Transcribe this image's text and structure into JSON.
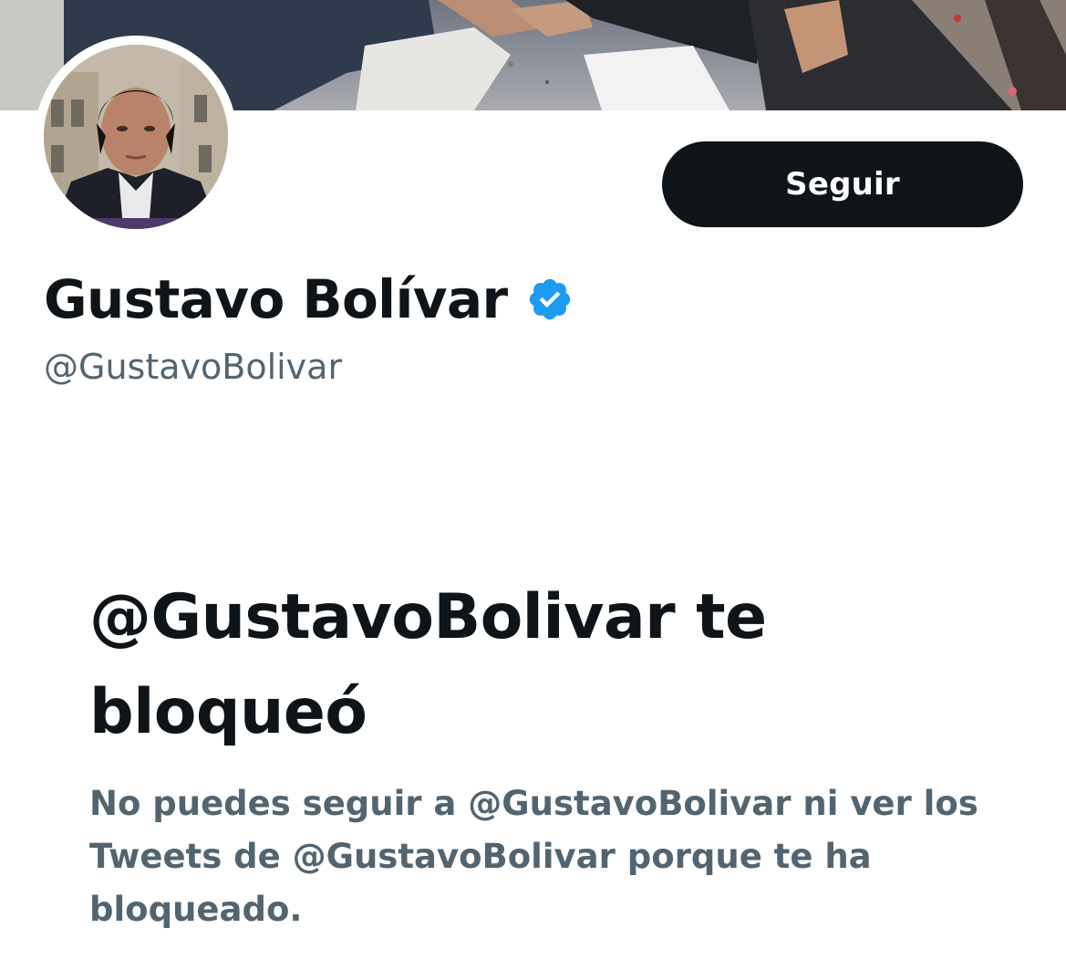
{
  "profile": {
    "display_name": "Gustavo Bolívar",
    "handle": "@GustavoBolivar",
    "verified_icon": "verified-badge-icon",
    "follow_label": "Seguir"
  },
  "blocked_notice": {
    "title": "@GustavoBolivar te bloqueó",
    "description": "No puedes seguir a @GustavoBolivar ni ver los Tweets de @GustavoBolivar porque te ha bloqueado."
  },
  "colors": {
    "text_primary": "#0f1419",
    "text_secondary": "#536471",
    "button_bg": "#0f1419",
    "verified_blue": "#1d9bf0",
    "background": "#ffffff"
  }
}
